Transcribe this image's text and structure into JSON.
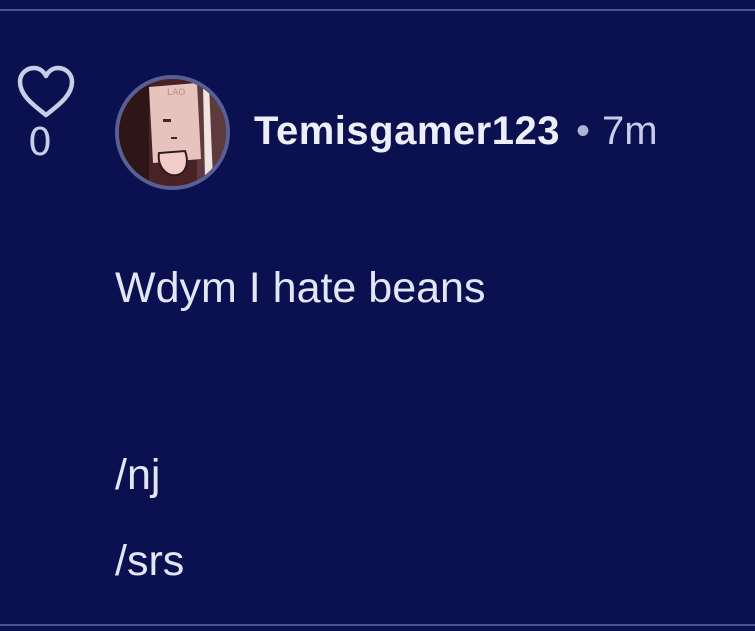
{
  "post": {
    "likes": "0",
    "author": "Temisgamer123",
    "separator": "•",
    "time": "7m",
    "lines": [
      "Wdym I hate beans",
      "",
      "/nj",
      "/srs"
    ]
  },
  "icons": {
    "like": "heart-outline-icon",
    "avatar": "user-avatar"
  },
  "colors": {
    "background": "#0b1150",
    "text": "#e3e6f4",
    "muted": "#c9cde6",
    "divider": "#4b5290"
  }
}
